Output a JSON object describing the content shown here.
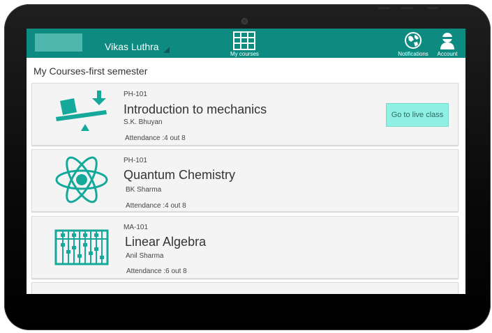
{
  "header": {
    "user_name": "Vikas Luthra",
    "nav": [
      {
        "label": "My courses",
        "icon": "grid-icon"
      },
      {
        "label": "Notifications",
        "icon": "globe-icon"
      },
      {
        "label": "Account",
        "icon": "person-icon"
      }
    ]
  },
  "page_title": "My Courses-first semester",
  "courses": [
    {
      "code": "PH-101",
      "title": "Introduction to mechanics",
      "teacher": "S.K. Bhuyan",
      "attendance": "Attendance :4 out 8",
      "action": "Go to live class",
      "icon": "seesaw-icon"
    },
    {
      "code": "PH-101",
      "title": "Quantum Chemistry",
      "teacher": "BK Sharma",
      "attendance": "Attendance :4 out 8",
      "icon": "atom-icon"
    },
    {
      "code": "MA-101",
      "title": "Linear Algebra",
      "teacher": "Anil Sharma",
      "attendance": "Attendance :6 out 8",
      "icon": "abacus-icon"
    }
  ],
  "colors": {
    "appbar": "#0e8b80",
    "accent": "#14a99a",
    "button": "#8ff0e4"
  }
}
